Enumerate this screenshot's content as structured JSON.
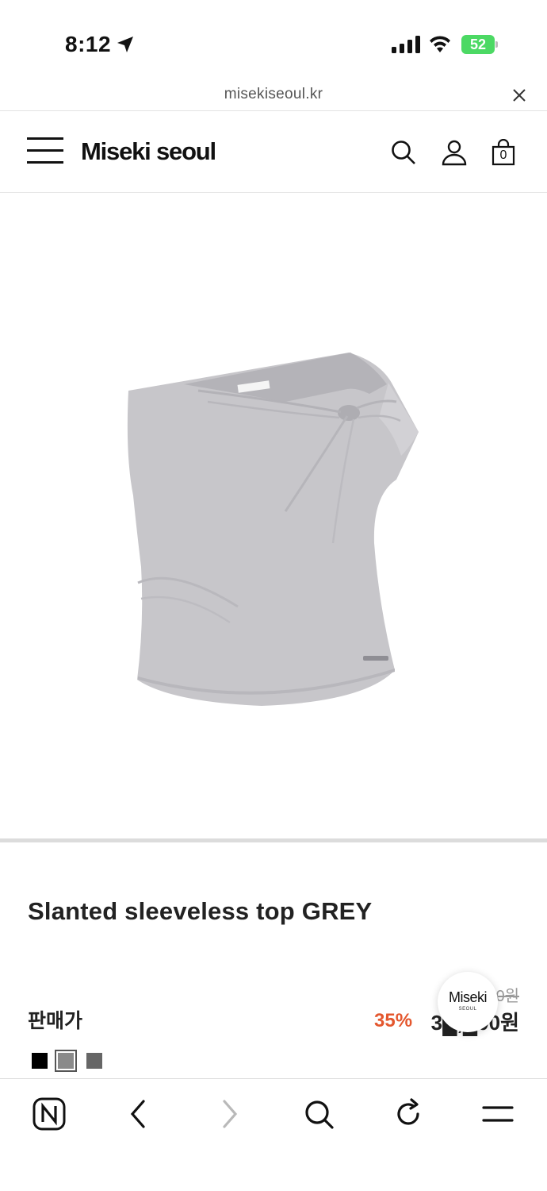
{
  "status_bar": {
    "time": "8:12",
    "battery": "52"
  },
  "url_bar": {
    "url": "misekiseoul.kr"
  },
  "header": {
    "brand": "Miseki seoul",
    "cart_count": "0"
  },
  "product": {
    "title": "Slanted sleeveless top GREY",
    "price_label": "판매가",
    "original_price": "5█,█00원",
    "discount": "35%",
    "sale_price": "3█,█00원",
    "swatches": [
      {
        "color": "#000000",
        "selected": false
      },
      {
        "color": "#8a8a8a",
        "selected": true
      },
      {
        "color": "#666666",
        "selected": false
      }
    ]
  },
  "floating_badge": {
    "line1": "Miseki",
    "line2": "SEOUL"
  },
  "colors": {
    "accent_discount": "#e4572e",
    "battery_green": "#4cd964"
  }
}
